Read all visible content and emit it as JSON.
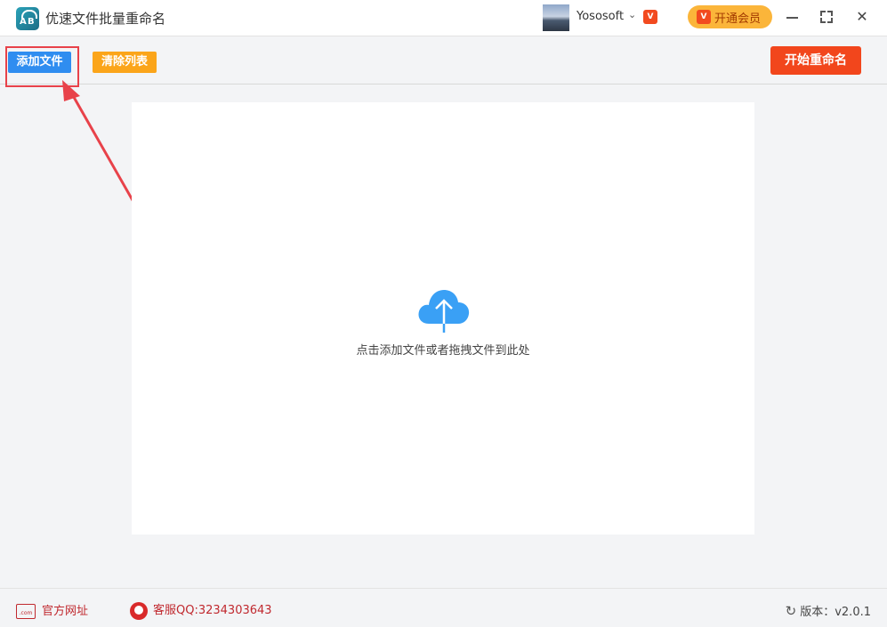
{
  "app": {
    "title": "优速文件批量重命名",
    "logo_letters": [
      "A",
      "B"
    ]
  },
  "account": {
    "username": "Yososoft",
    "vip_badge": "V",
    "vip_button_label": "开通会员"
  },
  "window_controls": {
    "close": "✕"
  },
  "toolbar": {
    "add_files_label": "添加文件",
    "clear_list_label": "清除列表",
    "start_rename_label": "开始重命名"
  },
  "drop_zone": {
    "hint": "点击添加文件或者拖拽文件到此处"
  },
  "statusbar": {
    "site_label": "官方网址",
    "site_icon_text": ".com",
    "support_label": "客服QQ:3234303643",
    "version_label": "版本：v2.0.1"
  },
  "colors": {
    "primary_blue": "#2f8df0",
    "clear_orange": "#fba51a",
    "start_red": "#f2461c",
    "vip_gold": "#fbb53a",
    "annotation_red": "#e8424a",
    "upload_icon": "#3aa0f5"
  },
  "icons": [
    "app-logo-icon",
    "avatar",
    "chevron-down-icon",
    "vip-icon",
    "minimize-icon",
    "maximize-icon",
    "close-icon",
    "cloud-upload-icon",
    "website-icon",
    "customer-service-icon",
    "refresh-icon"
  ]
}
